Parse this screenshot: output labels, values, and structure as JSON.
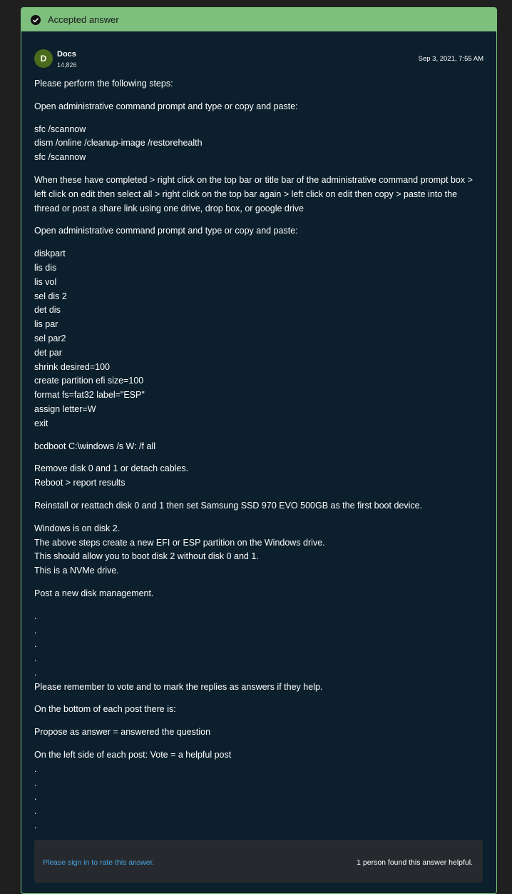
{
  "header": {
    "accepted_label": "Accepted answer"
  },
  "author": {
    "initial": "D",
    "name": "Docs",
    "reputation": "14,826",
    "date": "Sep 3, 2021, 7:55 AM"
  },
  "body": {
    "intro": "Please perform the following steps:",
    "step1_instruction": "Open administrative command prompt and type or copy and paste:",
    "commands1": [
      "sfc /scannow",
      "dism /online /cleanup-image /restorehealth",
      "sfc /scannow"
    ],
    "completed_instructions": "When these have completed > right click on the top bar or title bar of the administrative command prompt box > left click on edit then select all > right click on the top bar again > left click on edit then copy > paste into the thread or post a share link using one drive, drop box, or google drive",
    "step2_instruction": "Open administrative command prompt and type or copy and paste:",
    "commands2": [
      "diskpart",
      "lis dis",
      "lis vol",
      "sel dis 2",
      "det dis",
      "lis par",
      "sel par2",
      "det par",
      "shrink desired=100",
      "create partition efi size=100",
      "format fs=fat32 label=\"ESP\"",
      "assign letter=W",
      "exit"
    ],
    "bcdboot": "bcdboot C:\\windows /s W: /f all",
    "remove_lines": [
      "Remove disk 0 and 1 or detach cables.",
      "Reboot > report results"
    ],
    "reinstall": "Reinstall or reattach disk 0 and 1 then set Samsung SSD 970 EVO 500GB as the first boot device.",
    "windows_lines": [
      "Windows is on disk 2.",
      "The above steps create a new EFI or ESP partition on the Windows drive.",
      "This should allow you to boot disk 2 without disk 0 and 1.",
      "This is a NVMe drive."
    ],
    "post_new": "Post a new disk management.",
    "dots1": [
      ".",
      ".",
      ".",
      ".",
      "."
    ],
    "remember": "Please remember to vote and to mark the replies as answers if they help.",
    "bottom_of_post": "On the bottom of each post there is:",
    "propose": "Propose as answer = answered the question",
    "left_side": "On the left side of each post: Vote = a helpful post",
    "dots2": [
      ".",
      ".",
      ".",
      ".",
      "."
    ]
  },
  "footer": {
    "rate_link": "Please sign in to rate this answer.",
    "helpful_count": "1 person found this answer helpful."
  }
}
